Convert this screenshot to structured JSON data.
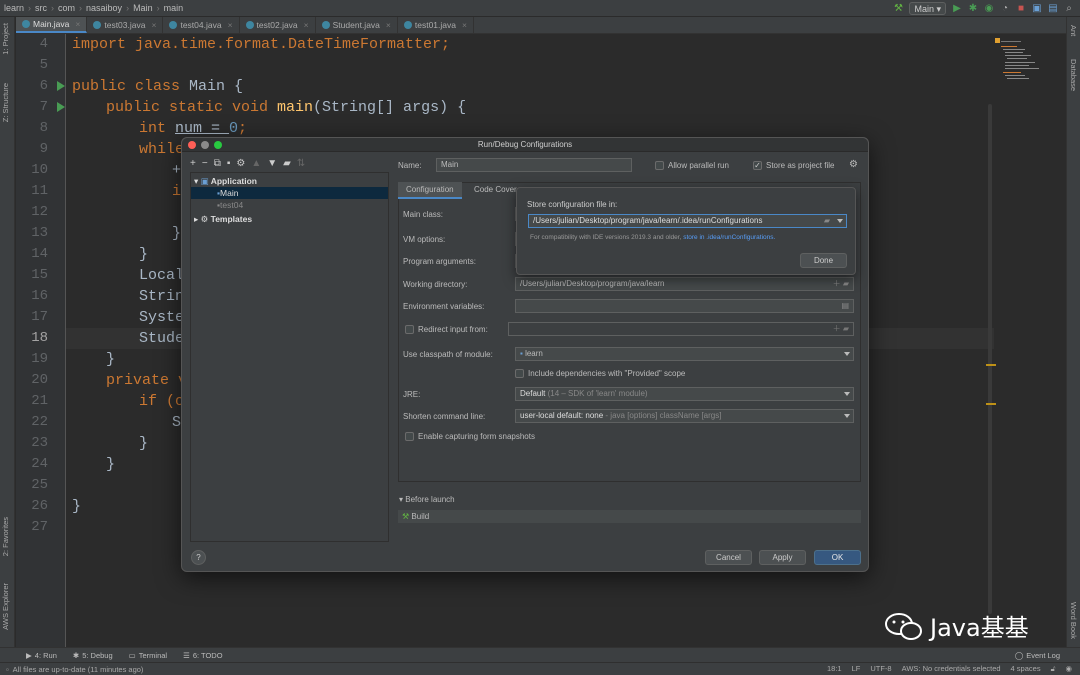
{
  "nav": {
    "crumbs": [
      "learn",
      "src",
      "com",
      "nasaiboy",
      "Main",
      "main"
    ],
    "run_config": "Main"
  },
  "tabs": [
    "Main.java",
    "test03.java",
    "test04.java",
    "test02.java",
    "Student.java",
    "test01.java"
  ],
  "left_strip": {
    "project": "1: Project",
    "structure": "Z: Structure",
    "favorites": "2: Favorites",
    "aws": "AWS Explorer"
  },
  "right_strip": {
    "ant": "Ant",
    "database": "Database",
    "wordbook": "Word Book"
  },
  "line_numbers": [
    "4",
    "5",
    "6",
    "7",
    "8",
    "9",
    "10",
    "11",
    "12",
    "13",
    "14",
    "15",
    "16",
    "17",
    "18",
    "19",
    "20",
    "21",
    "22",
    "23",
    "24",
    "25",
    "26",
    "27"
  ],
  "code": {
    "l4": [
      "import java.time.format.DateTimeFormatter;"
    ],
    "l6": [
      "public class ",
      "Main {"
    ],
    "l7": [
      "public static void ",
      "main",
      "(String[] args) {"
    ],
    "l8": [
      "int ",
      "num = ",
      "0",
      ";"
    ],
    "l9": [
      "while"
    ],
    "l10": [
      "+"
    ],
    "l11": [
      "i"
    ],
    "l13": [
      "}"
    ],
    "l14": [
      "}"
    ],
    "l15": [
      "Local"
    ],
    "l16": [
      "Strin"
    ],
    "l17": [
      "Syste"
    ],
    "l18": [
      "Stude"
    ],
    "l19": [
      "}"
    ],
    "l20": [
      "private v"
    ],
    "l21": [
      "if (o"
    ],
    "l22": [
      "S"
    ],
    "l23": [
      "}"
    ],
    "l24": [
      "}"
    ],
    "l26": [
      "}"
    ]
  },
  "dialog": {
    "title": "Run/Debug Configurations",
    "tree": {
      "application": "Application",
      "main": "Main",
      "test04": "test04",
      "templates": "Templates"
    },
    "name_label": "Name:",
    "name_value": "Main",
    "allow_parallel": "Allow parallel run",
    "store_project": "Store as project file",
    "tab_config": "Configuration",
    "tab_coverage": "Code Cover",
    "main_class": "Main class:",
    "vm_options": "VM options:",
    "program_args": "Program arguments:",
    "working_dir": "Working directory:",
    "working_dir_value": "/Users/julian/Desktop/program/java/learn",
    "env_vars": "Environment variables:",
    "redirect": "Redirect input from:",
    "classpath": "Use classpath of module:",
    "classpath_value": "learn",
    "include_deps": "Include dependencies with \"Provided\" scope",
    "jre": "JRE:",
    "jre_value": "Default",
    "jre_hint": "(14 – SDK of 'learn' module)",
    "shorten": "Shorten command line:",
    "shorten_value": "user-local default: none",
    "shorten_hint": "- java [options] className [args]",
    "snapshots": "Enable capturing form snapshots",
    "before_launch": "Before launch",
    "build": "Build",
    "cancel": "Cancel",
    "apply": "Apply",
    "ok": "OK",
    "help": "?"
  },
  "popup": {
    "title": "Store configuration file in:",
    "path": "/Users/julian/Desktop/program/java/learn/.idea/runConfigurations",
    "note": "For compatibility with IDE versions 2019.3 and older, ",
    "note_link": "store in .idea/runConfigurations.",
    "done": "Done"
  },
  "bottom": {
    "run": "4: Run",
    "debug": "5: Debug",
    "terminal": "Terminal",
    "todo": "6: TODO",
    "event_log": "Event Log"
  },
  "status": {
    "msg": "All files are up-to-date (11 minutes ago)",
    "pos": "18:1",
    "lf": "LF",
    "enc": "UTF-8",
    "aws": "AWS: No credentials selected",
    "indent": "4 spaces"
  },
  "watermark": "Java基基",
  "colors": {
    "keyword": "#cc7832",
    "function": "#ffc66d",
    "number": "#6897bb",
    "accent": "#4a88c7",
    "run": "#499c54"
  }
}
